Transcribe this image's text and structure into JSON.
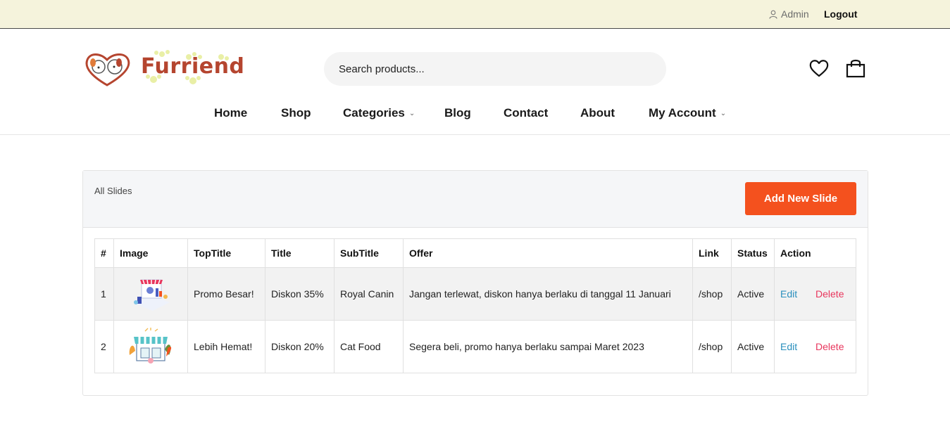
{
  "topbar": {
    "admin_label": "Admin",
    "logout_label": "Logout"
  },
  "header": {
    "logo_text": "Furriend",
    "search_placeholder": "Search products...",
    "icons": [
      "user-icon",
      "heart-icon",
      "shopping-bag-icon"
    ]
  },
  "nav": {
    "items": [
      {
        "label": "Home"
      },
      {
        "label": "Shop"
      },
      {
        "label": "Categories",
        "dropdown": true
      },
      {
        "label": "Blog"
      },
      {
        "label": "Contact"
      },
      {
        "label": "About"
      },
      {
        "label": "My Account",
        "dropdown": true
      }
    ]
  },
  "card": {
    "title": "All Slides",
    "add_button": "Add New Slide"
  },
  "table": {
    "columns": [
      "#",
      "Image",
      "TopTitle",
      "Title",
      "SubTitle",
      "Offer",
      "Link",
      "Status",
      "Action"
    ],
    "rows": [
      {
        "num": "1",
        "image_icon": "promo-store-illustration",
        "toptitle": "Promo Besar!",
        "title": "Diskon 35%",
        "subtitle": "Royal Canin",
        "offer": "Jangan terlewat, diskon hanya berlaku di tanggal 11 Januari",
        "link": "/shop",
        "status": "Active",
        "edit": "Edit",
        "delete": "Delete"
      },
      {
        "num": "2",
        "image_icon": "storefront-illustration",
        "toptitle": "Lebih Hemat!",
        "title": "Diskon 20%",
        "subtitle": "Cat Food",
        "offer": "Segera beli, promo hanya berlaku sampai Maret 2023",
        "link": "/shop",
        "status": "Active",
        "edit": "Edit",
        "delete": "Delete"
      }
    ]
  },
  "colors": {
    "topbar_bg": "#f5f3dc",
    "brand": "#b5452f",
    "accent_button": "#f4511e",
    "edit_link": "#2a8fbd",
    "delete_link": "#e8365d"
  }
}
